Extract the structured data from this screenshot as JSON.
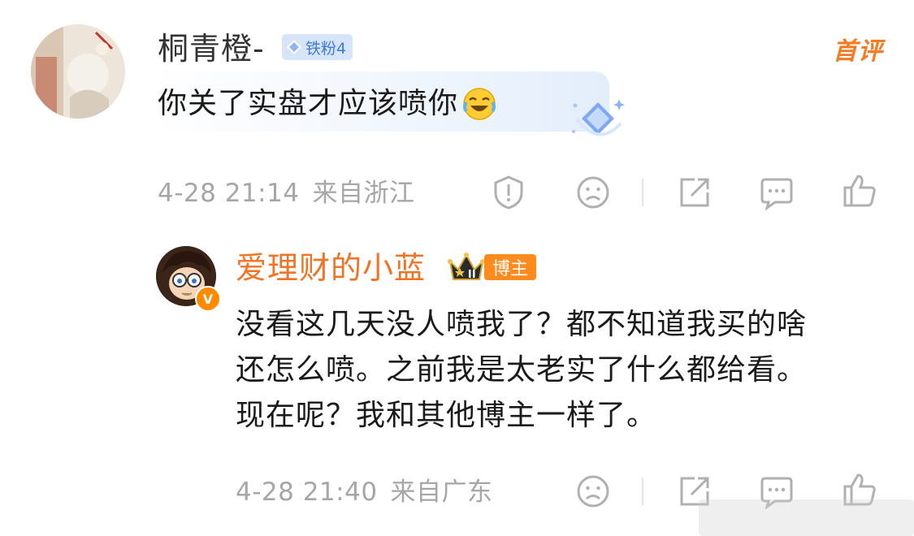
{
  "comment": {
    "username": "桐青橙-",
    "fan_badge": "铁粉4",
    "first_comment_label": "首评",
    "text": "你关了实盘才应该喷你",
    "emoji": "laugh-cry-emoji",
    "date": "4-28 21:14",
    "location": "来自浙江",
    "action_icons": [
      "report-icon",
      "dislike-icon",
      "share-icon",
      "comment-icon",
      "like-icon"
    ]
  },
  "reply": {
    "username": "爱理财的小蓝",
    "verified_badge": "V",
    "host_badge": "博主",
    "text_lines": [
      "没看这几天没人喷我了？都不知道我买的啥",
      "还怎么喷。之前我是太老实了什么都给看。",
      "现在呢？我和其他博主一样了。"
    ],
    "date": "4-28 21:40",
    "location": "来自广东",
    "action_icons": [
      "dislike-icon",
      "share-icon",
      "comment-icon",
      "like-icon"
    ]
  },
  "colors": {
    "accent_orange": "#f37325",
    "fan_badge_blue": "#3f79dc",
    "meta_gray": "#a6a6a6"
  }
}
